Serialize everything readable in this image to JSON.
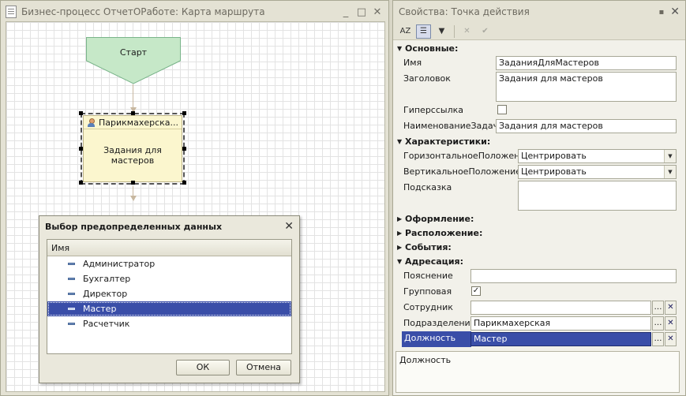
{
  "left_window": {
    "title": "Бизнес-процесс ОтчетОРаботе: Карта маршрута",
    "controls": [
      "_",
      "□",
      "✕"
    ]
  },
  "route_map": {
    "start_label": "Старт",
    "task_header": "Парикмахерска...",
    "task_body_line1": "Задания для",
    "task_body_line2": "мастеров"
  },
  "dialog": {
    "title": "Выбор предопределенных данных",
    "column_header": "Имя",
    "items": [
      "Администратор",
      "Бухгалтер",
      "Директор",
      "Мастер",
      "Расчетчик"
    ],
    "selected_item": "Мастер",
    "ok_label": "ОК",
    "cancel_label": "Отмена"
  },
  "properties": {
    "title": "Свойства: Точка действия",
    "toolbar": {
      "sort_label": "AZ",
      "check_label": "✔",
      "cancel_label": "✕"
    },
    "sections": {
      "basic": "Основные:",
      "characteristics": "Характеристики:",
      "appearance": "Оформление:",
      "placement": "Расположение:",
      "events": "События:",
      "addressing": "Адресация:"
    },
    "fields": {
      "name_label": "Имя",
      "name_value": "ЗаданияДляМастеров",
      "heading_label": "Заголовок",
      "heading_value": "Задания для мастеров",
      "hyperlink_label": "Гиперссылка",
      "task_name_label": "НаименованиеЗадачи",
      "task_name_value": "Задания для мастеров",
      "h_align_label": "ГоризонтальноеПоложение",
      "h_align_value": "Центрировать",
      "v_align_label": "ВертикальноеПоложение",
      "v_align_value": "Центрировать",
      "hint_label": "Подсказка",
      "hint_value": "",
      "explanation_label": "Пояснение",
      "explanation_value": "",
      "group_label": "Групповая",
      "group_checked": true,
      "employee_label": "Сотрудник",
      "employee_value": "",
      "department_label": "Подразделение",
      "department_value": "Парикмахерская",
      "position_label": "Должность",
      "position_value": "Мастер"
    },
    "description": "Должность"
  },
  "colors": {
    "start_fill": "#c6e8c8",
    "start_stroke": "#7ab48a",
    "task_fill": "#fbf6ce",
    "selection": "#3a4ea8"
  }
}
